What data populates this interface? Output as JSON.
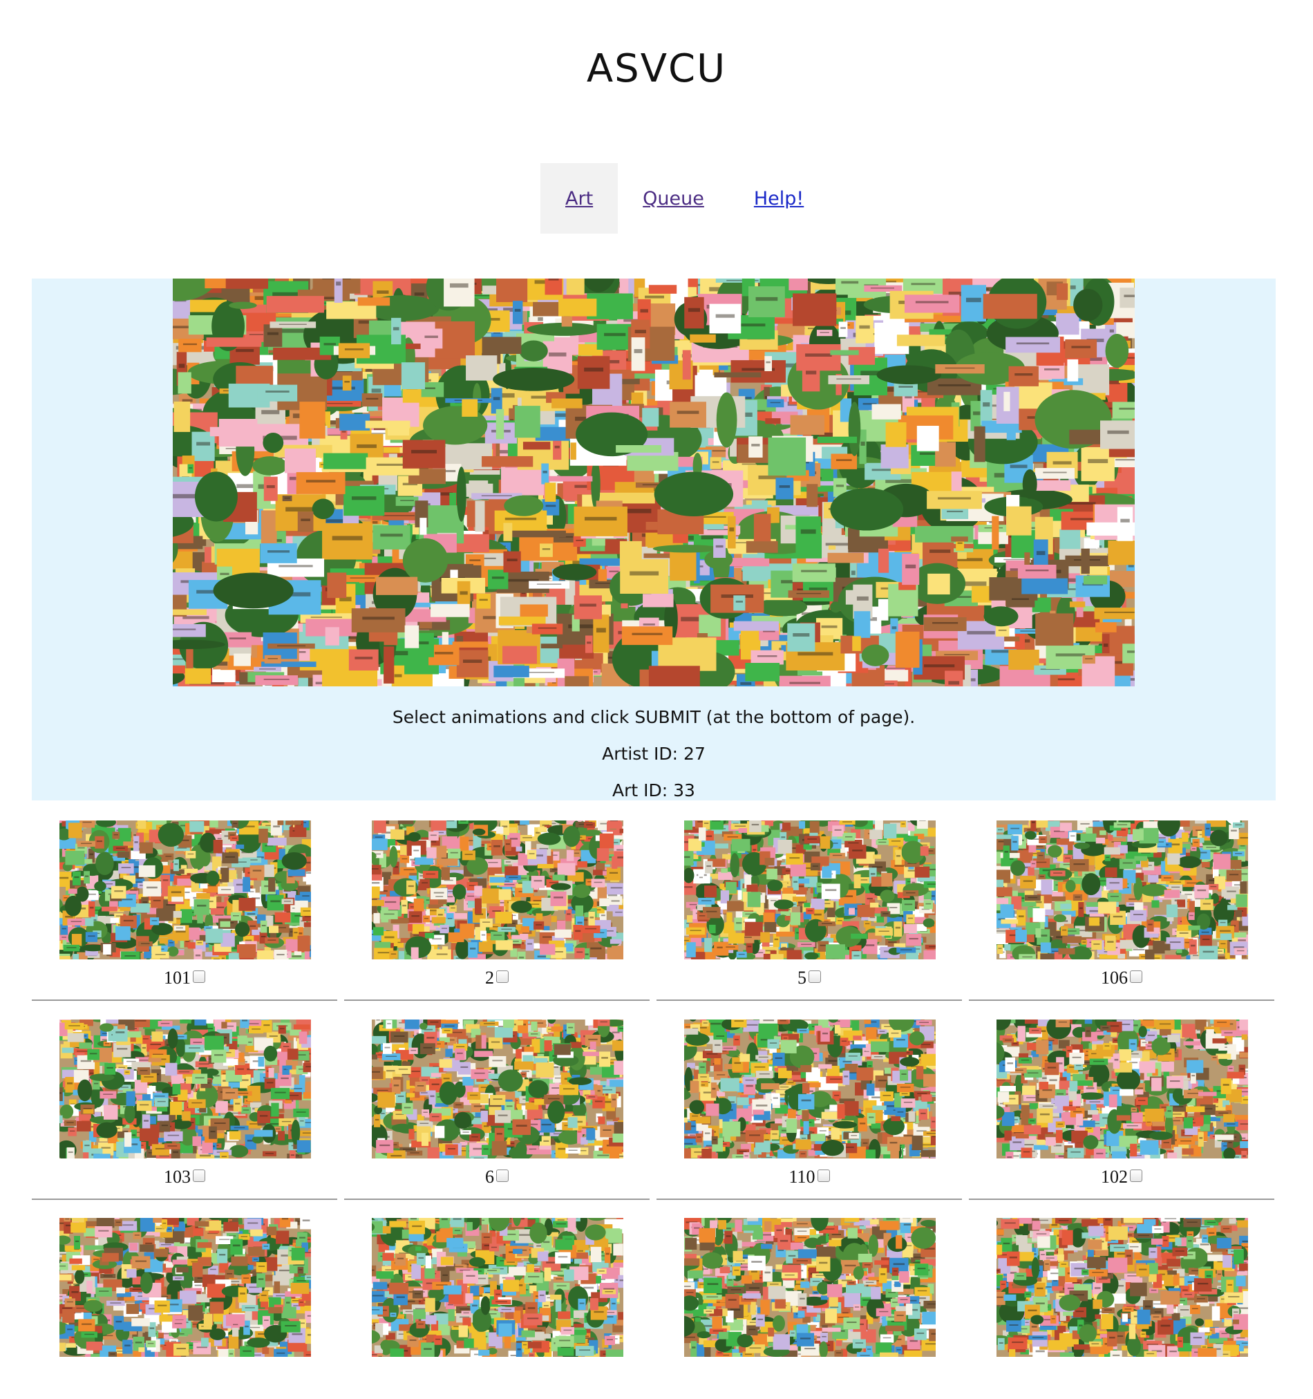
{
  "site": {
    "title": "ASVCU"
  },
  "nav": {
    "items": [
      {
        "label": "Art",
        "active": true
      },
      {
        "label": "Queue",
        "active": false
      },
      {
        "label": "Help!",
        "active": false
      }
    ]
  },
  "hero": {
    "image": "aerial-colorful-city-photo",
    "instruction": "Select animations and click SUBMIT (at the bottom of page).",
    "artist_id": "Artist ID: 27",
    "art_id": "Art ID: 33"
  },
  "animations": [
    {
      "number": "101",
      "checked": false
    },
    {
      "number": "2",
      "checked": false
    },
    {
      "number": "5",
      "checked": false
    },
    {
      "number": "106",
      "checked": false
    },
    {
      "number": "103",
      "checked": false
    },
    {
      "number": "6",
      "checked": false
    },
    {
      "number": "110",
      "checked": false
    },
    {
      "number": "102",
      "checked": false
    },
    {
      "number": "",
      "checked": false
    },
    {
      "number": "",
      "checked": false
    },
    {
      "number": "",
      "checked": false
    },
    {
      "number": "",
      "checked": false
    }
  ],
  "colors": {
    "hero_background": "#e3f4fd",
    "nav_active_background": "#f2f2f2",
    "nav_link": "#4b2c83",
    "nav_help_link": "#1a28c8"
  }
}
